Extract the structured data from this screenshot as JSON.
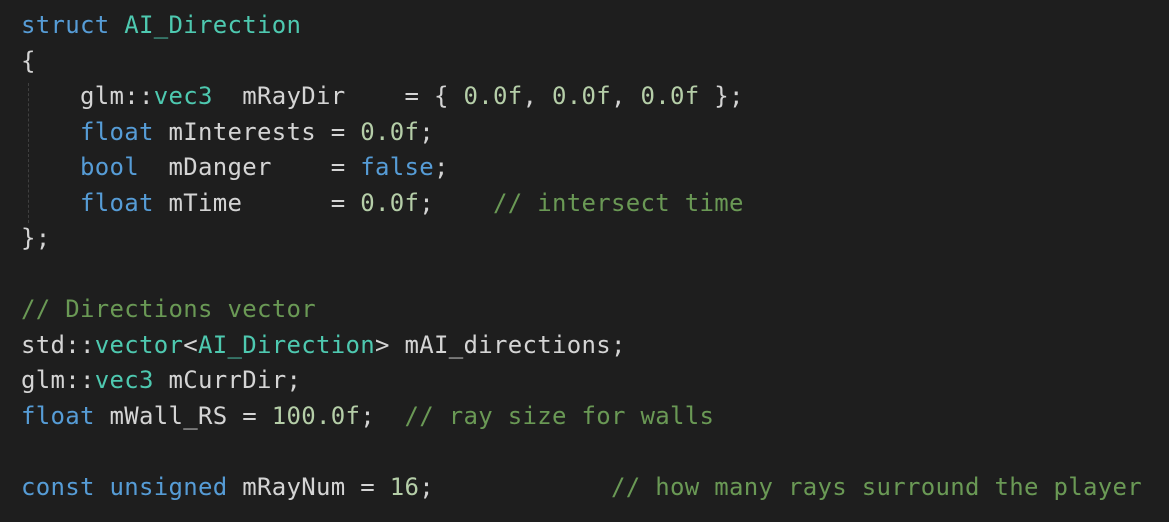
{
  "code": {
    "lines": [
      [
        {
          "t": "struct ",
          "c": "kw"
        },
        {
          "t": "AI_Direction",
          "c": "type"
        }
      ],
      [
        {
          "t": "{",
          "c": "tx"
        }
      ],
      [
        {
          "t": "    glm::",
          "c": "tx"
        },
        {
          "t": "vec3",
          "c": "type"
        },
        {
          "t": "  mRayDir    = { ",
          "c": "tx"
        },
        {
          "t": "0.0f",
          "c": "num"
        },
        {
          "t": ", ",
          "c": "tx"
        },
        {
          "t": "0.0f",
          "c": "num"
        },
        {
          "t": ", ",
          "c": "tx"
        },
        {
          "t": "0.0f",
          "c": "num"
        },
        {
          "t": " };",
          "c": "tx"
        }
      ],
      [
        {
          "t": "    ",
          "c": "tx"
        },
        {
          "t": "float",
          "c": "kw"
        },
        {
          "t": " mInterests = ",
          "c": "tx"
        },
        {
          "t": "0.0f",
          "c": "num"
        },
        {
          "t": ";",
          "c": "tx"
        }
      ],
      [
        {
          "t": "    ",
          "c": "tx"
        },
        {
          "t": "bool",
          "c": "kw"
        },
        {
          "t": "  mDanger    = ",
          "c": "tx"
        },
        {
          "t": "false",
          "c": "kw"
        },
        {
          "t": ";",
          "c": "tx"
        }
      ],
      [
        {
          "t": "    ",
          "c": "tx"
        },
        {
          "t": "float",
          "c": "kw"
        },
        {
          "t": " mTime      = ",
          "c": "tx"
        },
        {
          "t": "0.0f",
          "c": "num"
        },
        {
          "t": ";    ",
          "c": "tx"
        },
        {
          "t": "// intersect time",
          "c": "cm"
        }
      ],
      [
        {
          "t": "};",
          "c": "tx"
        }
      ],
      [],
      [
        {
          "t": "// Directions vector",
          "c": "cm"
        }
      ],
      [
        {
          "t": "std::",
          "c": "tx"
        },
        {
          "t": "vector",
          "c": "type"
        },
        {
          "t": "<",
          "c": "tx"
        },
        {
          "t": "AI_Direction",
          "c": "type"
        },
        {
          "t": "> mAI_directions;",
          "c": "tx"
        }
      ],
      [
        {
          "t": "glm::",
          "c": "tx"
        },
        {
          "t": "vec3",
          "c": "type"
        },
        {
          "t": " mCurrDir;",
          "c": "tx"
        }
      ],
      [
        {
          "t": "float",
          "c": "kw"
        },
        {
          "t": " mWall_RS = ",
          "c": "tx"
        },
        {
          "t": "100.0f",
          "c": "num"
        },
        {
          "t": ";  ",
          "c": "tx"
        },
        {
          "t": "// ray size for walls",
          "c": "cm"
        }
      ],
      [],
      [
        {
          "t": "const",
          "c": "kw"
        },
        {
          "t": " ",
          "c": "tx"
        },
        {
          "t": "unsigned",
          "c": "kw"
        },
        {
          "t": " mRayNum = ",
          "c": "tx"
        },
        {
          "t": "16",
          "c": "num"
        },
        {
          "t": ";            ",
          "c": "tx"
        },
        {
          "t": "// how many rays surround the player",
          "c": "cm"
        }
      ]
    ]
  },
  "colors": {
    "background": "#1e1e1e",
    "keyword": "#569cd6",
    "type": "#4ec9b0",
    "number": "#b5cea8",
    "comment": "#6a9955",
    "text": "#d4d4d4"
  }
}
